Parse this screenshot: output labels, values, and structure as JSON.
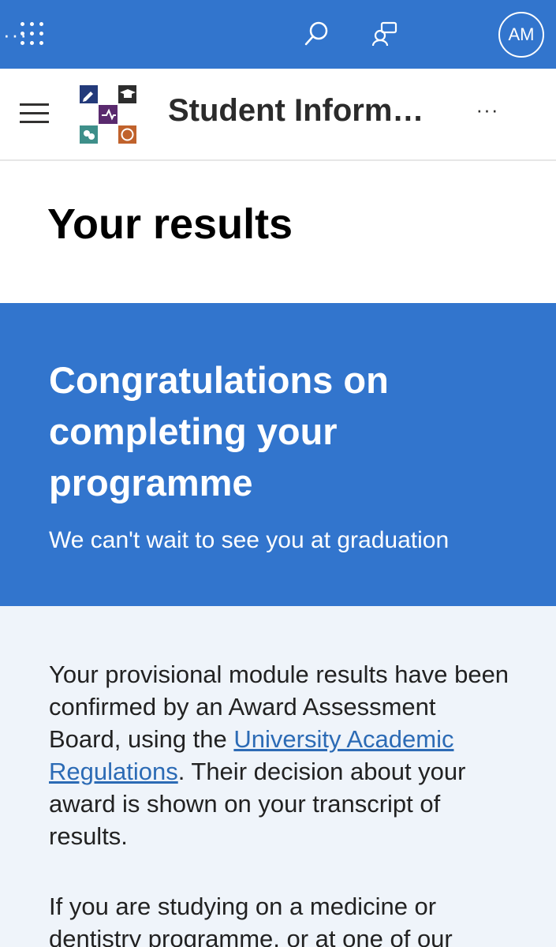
{
  "suite_bar": {
    "avatar_initials": "AM",
    "more_glyph": "···"
  },
  "site_header": {
    "title": "Student Inform…",
    "more_glyph": "···"
  },
  "page": {
    "title": "Your results"
  },
  "hero": {
    "heading": "Congratulations on completing your programme",
    "subheading": "We can't wait to see you at graduation"
  },
  "content": {
    "para1_before": "Your provisional module results have been confirmed by an Award Assessment Board, using the ",
    "para1_link": "University Academic Regulations",
    "para1_after": ". Their decision about your award is shown on your transcript of results.",
    "para2": "If you are studying on a medicine or dentistry programme, or at one of our"
  },
  "colors": {
    "brand_blue": "#3275cd",
    "content_bg": "#eff4fa",
    "link": "#2c6bb5"
  },
  "icons": {
    "waffle": "app-launcher-icon",
    "search": "search-icon",
    "feedback": "feedback-icon",
    "menu": "hamburger-icon"
  }
}
